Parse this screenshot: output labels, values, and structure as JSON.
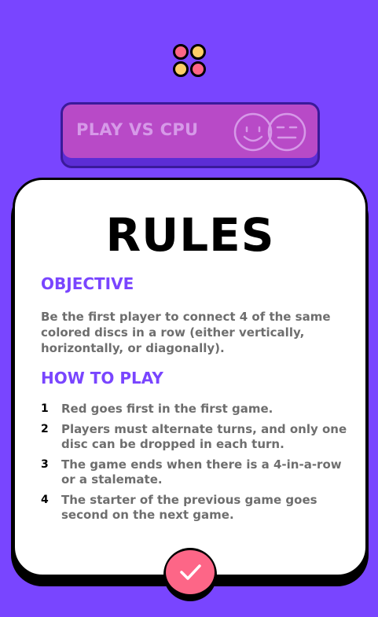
{
  "colors": {
    "background": "#7945FF",
    "accent_pink": "#FD6687",
    "accent_yellow": "#FFCE67",
    "cpu_button": "#B84AC7",
    "card": "#FFFFFF"
  },
  "logo": {
    "icon": "four-discs-logo-icon"
  },
  "cpu_button": {
    "label": "PLAY VS CPU",
    "icons": [
      "smiley-face-icon",
      "neutral-face-icon"
    ]
  },
  "rules": {
    "title": "RULES",
    "objective": {
      "heading": "OBJECTIVE",
      "text": "Be the first player to connect 4 of the same colored discs in a row (either vertically, horizontally, or diagonally)."
    },
    "how_to_play": {
      "heading": "HOW TO PLAY",
      "steps": [
        {
          "num": "1",
          "text": "Red goes first in the first game."
        },
        {
          "num": "2",
          "text": "Players must alternate turns, and only one disc can be dropped in each turn."
        },
        {
          "num": "3",
          "text": "The game ends when there is a 4-in-a-row or a stalemate."
        },
        {
          "num": "4",
          "text": "The starter of the previous game goes second on the next game."
        }
      ]
    }
  },
  "confirm_button": {
    "icon": "check-icon"
  }
}
